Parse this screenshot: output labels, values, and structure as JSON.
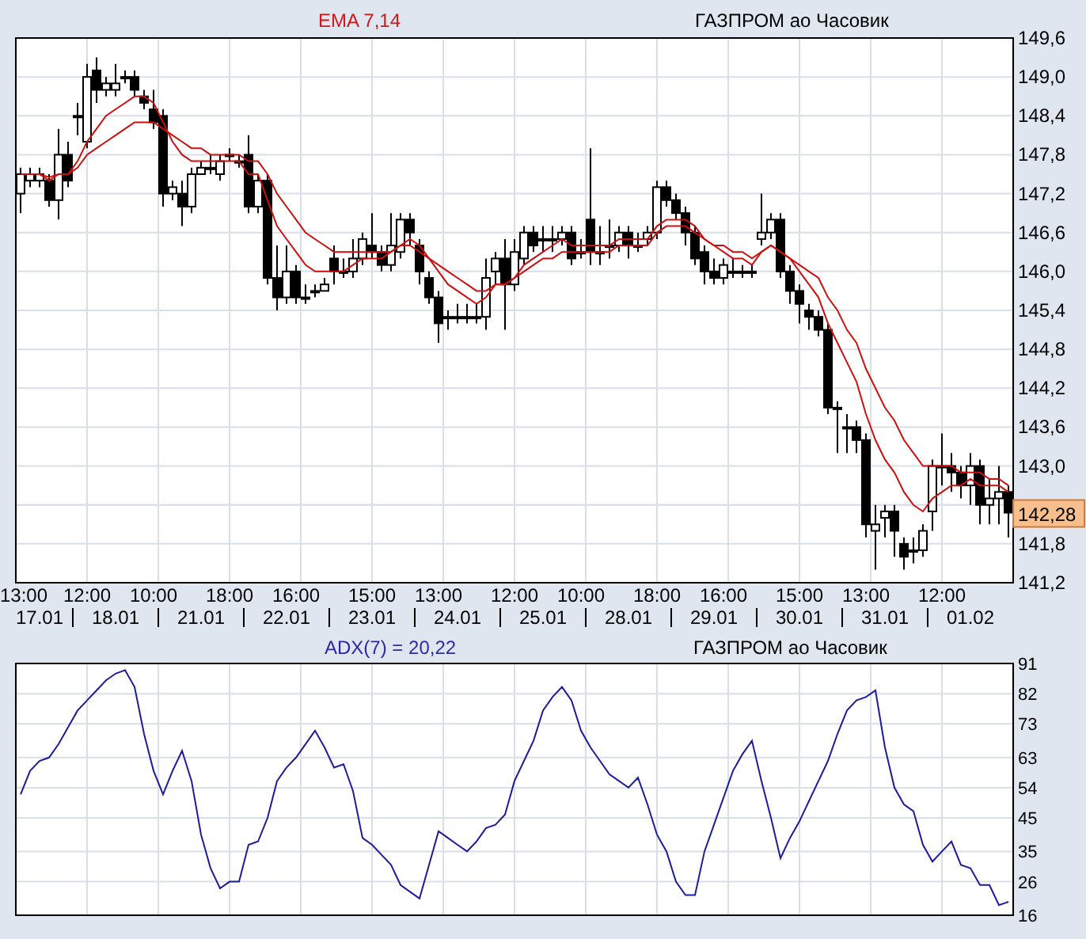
{
  "price_panel": {
    "indicator_label": "EMA 7,14",
    "instrument": "ГАЗПРОМ ао Часовик",
    "last_price": "142,28",
    "date_labels": [
      "17.01",
      "18.01",
      "21.01",
      "22.01",
      "23.01",
      "24.01",
      "25.01",
      "28.01",
      "29.01",
      "30.01",
      "31.01",
      "01.02"
    ],
    "chart_data": {
      "type": "candlestick",
      "grid": true,
      "ylim": [
        141.2,
        149.6
      ],
      "yticks": [
        {
          "value": 149.6,
          "label": "149,6"
        },
        {
          "value": 149.0,
          "label": "149,0"
        },
        {
          "value": 148.4,
          "label": "148,4"
        },
        {
          "value": 147.8,
          "label": "147,8"
        },
        {
          "value": 147.2,
          "label": "147,2"
        },
        {
          "value": 146.6,
          "label": "146,6"
        },
        {
          "value": 146.0,
          "label": "146,0"
        },
        {
          "value": 145.4,
          "label": "145,4"
        },
        {
          "value": 144.8,
          "label": "144,8"
        },
        {
          "value": 144.2,
          "label": "144,2"
        },
        {
          "value": 143.6,
          "label": "143,6"
        },
        {
          "value": 143.0,
          "label": "143,0"
        },
        {
          "value": 141.8,
          "label": "141,8"
        },
        {
          "value": 141.2,
          "label": "141,2"
        }
      ],
      "categories": [
        "13:00",
        null,
        null,
        null,
        null,
        null,
        null,
        "12:00",
        null,
        null,
        null,
        null,
        null,
        null,
        "10:00",
        null,
        null,
        null,
        null,
        null,
        null,
        null,
        "18:00",
        null,
        null,
        null,
        null,
        null,
        null,
        "16:00",
        null,
        null,
        null,
        null,
        null,
        null,
        null,
        "15:00",
        null,
        null,
        null,
        null,
        null,
        null,
        "13:00",
        null,
        null,
        null,
        null,
        null,
        null,
        null,
        "12:00",
        null,
        null,
        null,
        null,
        null,
        null,
        "10:00",
        null,
        null,
        null,
        null,
        null,
        null,
        null,
        "18:00",
        null,
        null,
        null,
        null,
        null,
        null,
        "16:00",
        null,
        null,
        null,
        null,
        null,
        null,
        null,
        "15:00",
        null,
        null,
        null,
        null,
        null,
        null,
        "13:00",
        null,
        null,
        null,
        null,
        null,
        null,
        null,
        "12:00",
        null,
        null,
        null,
        null,
        null,
        null,
        null
      ],
      "ohlc": [
        [
          147.2,
          147.6,
          146.9,
          147.5
        ],
        [
          147.4,
          147.6,
          147.3,
          147.5
        ],
        [
          147.4,
          147.6,
          147.3,
          147.5
        ],
        [
          147.4,
          147.5,
          147.0,
          147.1
        ],
        [
          147.1,
          148.2,
          146.8,
          147.8
        ],
        [
          147.8,
          148.0,
          147.3,
          147.4
        ],
        [
          148.4,
          148.6,
          148.1,
          148.4
        ],
        [
          148.0,
          149.2,
          147.9,
          149.0
        ],
        [
          149.1,
          149.3,
          148.6,
          148.8
        ],
        [
          148.8,
          149.0,
          148.7,
          148.9
        ],
        [
          148.8,
          149.2,
          148.7,
          148.9
        ],
        [
          149.0,
          149.1,
          148.9,
          149.0
        ],
        [
          149.0,
          149.1,
          148.7,
          148.8
        ],
        [
          148.7,
          148.8,
          148.5,
          148.6
        ],
        [
          148.5,
          148.8,
          148.2,
          148.3
        ],
        [
          148.4,
          148.5,
          147.0,
          147.2
        ],
        [
          147.2,
          147.4,
          147.1,
          147.3
        ],
        [
          147.2,
          147.4,
          146.7,
          147.0
        ],
        [
          147.0,
          147.6,
          146.9,
          147.5
        ],
        [
          147.5,
          147.7,
          147.5,
          147.6
        ],
        [
          147.6,
          147.8,
          147.5,
          147.6
        ],
        [
          147.5,
          147.8,
          147.4,
          147.7
        ],
        [
          147.8,
          147.9,
          147.7,
          147.8
        ],
        [
          147.7,
          147.8,
          147.6,
          147.7
        ],
        [
          147.8,
          148.1,
          146.9,
          147.0
        ],
        [
          147.0,
          147.5,
          146.9,
          147.4
        ],
        [
          147.4,
          147.5,
          145.8,
          145.9
        ],
        [
          145.9,
          146.4,
          145.4,
          145.6
        ],
        [
          145.6,
          146.4,
          145.5,
          146.0
        ],
        [
          146.0,
          146.1,
          145.5,
          145.6
        ],
        [
          145.6,
          145.8,
          145.5,
          145.6
        ],
        [
          145.7,
          145.8,
          145.6,
          145.7
        ],
        [
          145.7,
          145.9,
          145.7,
          145.8
        ],
        [
          146.2,
          146.4,
          145.8,
          146.0
        ],
        [
          146.0,
          146.2,
          145.9,
          146.0
        ],
        [
          146.0,
          146.5,
          145.9,
          146.2
        ],
        [
          146.2,
          146.6,
          146.1,
          146.5
        ],
        [
          146.4,
          146.9,
          146.2,
          146.3
        ],
        [
          146.3,
          146.4,
          146.0,
          146.1
        ],
        [
          146.1,
          146.9,
          146.0,
          146.4
        ],
        [
          146.3,
          146.9,
          146.2,
          146.8
        ],
        [
          146.8,
          146.9,
          146.4,
          146.6
        ],
        [
          146.4,
          146.5,
          145.8,
          146.0
        ],
        [
          145.9,
          146.0,
          145.5,
          145.6
        ],
        [
          145.6,
          145.7,
          144.9,
          145.2
        ],
        [
          145.3,
          145.4,
          145.1,
          145.3
        ],
        [
          145.3,
          145.5,
          145.2,
          145.3
        ],
        [
          145.3,
          145.5,
          145.2,
          145.3
        ],
        [
          145.3,
          145.5,
          145.2,
          145.3
        ],
        [
          145.3,
          146.2,
          145.1,
          145.9
        ],
        [
          146.0,
          146.3,
          145.8,
          146.2
        ],
        [
          146.2,
          146.5,
          145.1,
          145.8
        ],
        [
          145.8,
          146.5,
          145.7,
          146.3
        ],
        [
          146.2,
          146.7,
          146.1,
          146.6
        ],
        [
          146.6,
          146.7,
          146.3,
          146.4
        ],
        [
          146.5,
          146.7,
          146.3,
          146.5
        ],
        [
          146.5,
          146.7,
          146.3,
          146.5
        ],
        [
          146.5,
          146.7,
          146.4,
          146.6
        ],
        [
          146.6,
          146.7,
          146.1,
          146.2
        ],
        [
          146.3,
          146.5,
          146.2,
          146.3
        ],
        [
          146.8,
          147.9,
          146.1,
          146.3
        ],
        [
          146.3,
          146.7,
          146.1,
          146.3
        ],
        [
          146.4,
          146.8,
          146.2,
          146.4
        ],
        [
          146.4,
          146.7,
          146.3,
          146.6
        ],
        [
          146.6,
          146.7,
          146.2,
          146.4
        ],
        [
          146.4,
          146.6,
          146.3,
          146.4
        ],
        [
          146.5,
          146.7,
          146.4,
          146.6
        ],
        [
          146.6,
          147.4,
          146.5,
          147.3
        ],
        [
          147.3,
          147.4,
          147.0,
          147.1
        ],
        [
          147.1,
          147.2,
          146.8,
          146.9
        ],
        [
          146.9,
          147.0,
          146.4,
          146.6
        ],
        [
          146.6,
          146.7,
          146.1,
          146.2
        ],
        [
          146.3,
          146.4,
          145.8,
          146.0
        ],
        [
          146.0,
          146.2,
          145.8,
          145.9
        ],
        [
          145.9,
          146.2,
          145.8,
          146.1
        ],
        [
          146.0,
          146.2,
          145.9,
          146.0
        ],
        [
          146.0,
          146.1,
          145.9,
          146.0
        ],
        [
          146.0,
          146.1,
          145.9,
          146.0
        ],
        [
          146.5,
          147.2,
          146.4,
          146.6
        ],
        [
          146.6,
          146.9,
          146.5,
          146.8
        ],
        [
          146.8,
          146.9,
          145.9,
          146.0
        ],
        [
          146.0,
          146.1,
          145.5,
          145.7
        ],
        [
          145.7,
          145.8,
          145.2,
          145.5
        ],
        [
          145.4,
          145.5,
          145.1,
          145.3
        ],
        [
          145.3,
          145.4,
          145.0,
          145.1
        ],
        [
          145.1,
          145.2,
          143.8,
          143.9
        ],
        [
          143.9,
          144.0,
          143.2,
          143.9
        ],
        [
          143.6,
          143.8,
          143.2,
          143.6
        ],
        [
          143.6,
          143.7,
          143.2,
          143.4
        ],
        [
          143.4,
          143.5,
          141.9,
          142.1
        ],
        [
          142.0,
          142.4,
          141.4,
          142.1
        ],
        [
          142.2,
          142.4,
          141.9,
          142.3
        ],
        [
          142.3,
          142.4,
          141.6,
          142.0
        ],
        [
          141.8,
          141.9,
          141.4,
          141.6
        ],
        [
          141.7,
          141.9,
          141.5,
          141.7
        ],
        [
          141.7,
          142.1,
          141.6,
          142.0
        ],
        [
          142.3,
          143.1,
          142.0,
          143.0
        ],
        [
          143.0,
          143.5,
          142.7,
          143.0
        ],
        [
          143.0,
          143.2,
          142.6,
          142.9
        ],
        [
          142.9,
          143.0,
          142.5,
          142.7
        ],
        [
          142.7,
          143.2,
          142.4,
          143.0
        ],
        [
          143.0,
          143.1,
          142.1,
          142.4
        ],
        [
          142.4,
          142.8,
          142.1,
          142.5
        ],
        [
          142.5,
          143.0,
          142.1,
          142.6
        ],
        [
          142.6,
          142.7,
          141.9,
          142.28
        ]
      ],
      "series": [
        {
          "type": "line",
          "color": "#cc1010",
          "values": [
            147.5,
            147.5,
            147.5,
            147.4,
            147.5,
            147.5,
            147.7,
            148.0,
            148.2,
            148.4,
            148.5,
            148.6,
            148.7,
            148.7,
            148.6,
            148.3,
            148.0,
            147.8,
            147.7,
            147.7,
            147.7,
            147.7,
            147.7,
            147.7,
            147.5,
            147.5,
            147.1,
            146.7,
            146.5,
            146.3,
            146.1,
            146.0,
            146.0,
            146.0,
            146.0,
            146.1,
            146.2,
            146.2,
            146.2,
            146.3,
            146.4,
            146.5,
            146.4,
            146.2,
            146.0,
            145.8,
            145.7,
            145.6,
            145.5,
            145.6,
            145.8,
            145.8,
            145.9,
            146.1,
            146.2,
            146.3,
            146.4,
            146.5,
            146.4,
            146.4,
            146.4,
            146.4,
            146.4,
            146.5,
            146.5,
            146.5,
            146.5,
            146.7,
            146.8,
            146.8,
            146.8,
            146.7,
            146.5,
            146.4,
            146.3,
            146.2,
            146.2,
            146.1,
            146.3,
            146.4,
            146.3,
            146.2,
            146.0,
            145.8,
            145.6,
            145.2,
            144.9,
            144.6,
            144.3,
            143.8,
            143.4,
            143.1,
            142.9,
            142.6,
            142.4,
            142.3,
            142.5,
            142.6,
            142.7,
            142.7,
            142.8,
            142.7,
            142.7,
            142.7,
            142.6
          ]
        },
        {
          "type": "line",
          "color": "#cc1010",
          "values": [
            147.5,
            147.5,
            147.5,
            147.45,
            147.5,
            147.5,
            147.6,
            147.8,
            147.9,
            148.0,
            148.1,
            148.2,
            148.3,
            148.3,
            148.3,
            148.2,
            148.1,
            148.0,
            147.9,
            147.9,
            147.8,
            147.8,
            147.8,
            147.8,
            147.7,
            147.7,
            147.5,
            147.2,
            147.0,
            146.8,
            146.6,
            146.5,
            146.4,
            146.3,
            146.3,
            146.3,
            146.3,
            146.3,
            146.3,
            146.3,
            146.4,
            146.4,
            146.3,
            146.2,
            146.1,
            146.0,
            145.9,
            145.8,
            145.7,
            145.7,
            145.8,
            145.8,
            145.9,
            146.0,
            146.1,
            146.2,
            146.2,
            146.3,
            146.3,
            146.3,
            146.3,
            146.3,
            146.3,
            146.4,
            146.4,
            146.4,
            146.4,
            146.6,
            146.7,
            146.7,
            146.7,
            146.6,
            146.5,
            146.4,
            146.4,
            146.3,
            146.3,
            146.2,
            146.3,
            146.4,
            146.3,
            146.2,
            146.1,
            146.0,
            145.9,
            145.6,
            145.4,
            145.1,
            144.9,
            144.5,
            144.2,
            143.9,
            143.7,
            143.4,
            143.2,
            143.0,
            143.0,
            143.0,
            143.0,
            142.9,
            142.9,
            142.9,
            142.8,
            142.8,
            142.7
          ]
        }
      ]
    }
  },
  "adx_panel": {
    "indicator_label": "ADX(7) = 20,22",
    "instrument": "ГАЗПРОМ ао Часовик",
    "chart_data": {
      "type": "line",
      "grid": true,
      "ylim": [
        16,
        91
      ],
      "yticks": [
        {
          "value": 91,
          "label": "91"
        },
        {
          "value": 82,
          "label": "82"
        },
        {
          "value": 73,
          "label": "73"
        },
        {
          "value": 63,
          "label": "63"
        },
        {
          "value": 54,
          "label": "54"
        },
        {
          "value": 45,
          "label": "45"
        },
        {
          "value": 35,
          "label": "35"
        },
        {
          "value": 26,
          "label": "26"
        },
        {
          "value": 16,
          "label": "16"
        }
      ],
      "series": [
        {
          "color": "#1c1c9c",
          "values": [
            52,
            59,
            62,
            63,
            67,
            72,
            77,
            80,
            83,
            86,
            88,
            89,
            84,
            70,
            59,
            52,
            59,
            65,
            56,
            40,
            30,
            24,
            26,
            26,
            37,
            38,
            45,
            56,
            60,
            63,
            67,
            71,
            66,
            60,
            61,
            53,
            39,
            37,
            34,
            31,
            25,
            23,
            21,
            31,
            41,
            39,
            37,
            35,
            38,
            42,
            43,
            46,
            56,
            62,
            68,
            77,
            81,
            84,
            80,
            71,
            66,
            62,
            58,
            56,
            54,
            57,
            49,
            40,
            35,
            26,
            22,
            22,
            35,
            43,
            51,
            59,
            64,
            68,
            56,
            45,
            33,
            39,
            44,
            50,
            56,
            62,
            70,
            77,
            80,
            81,
            83,
            66,
            54,
            49,
            47,
            37,
            32,
            35,
            38,
            31,
            30,
            25,
            25,
            19,
            20
          ]
        }
      ]
    }
  }
}
